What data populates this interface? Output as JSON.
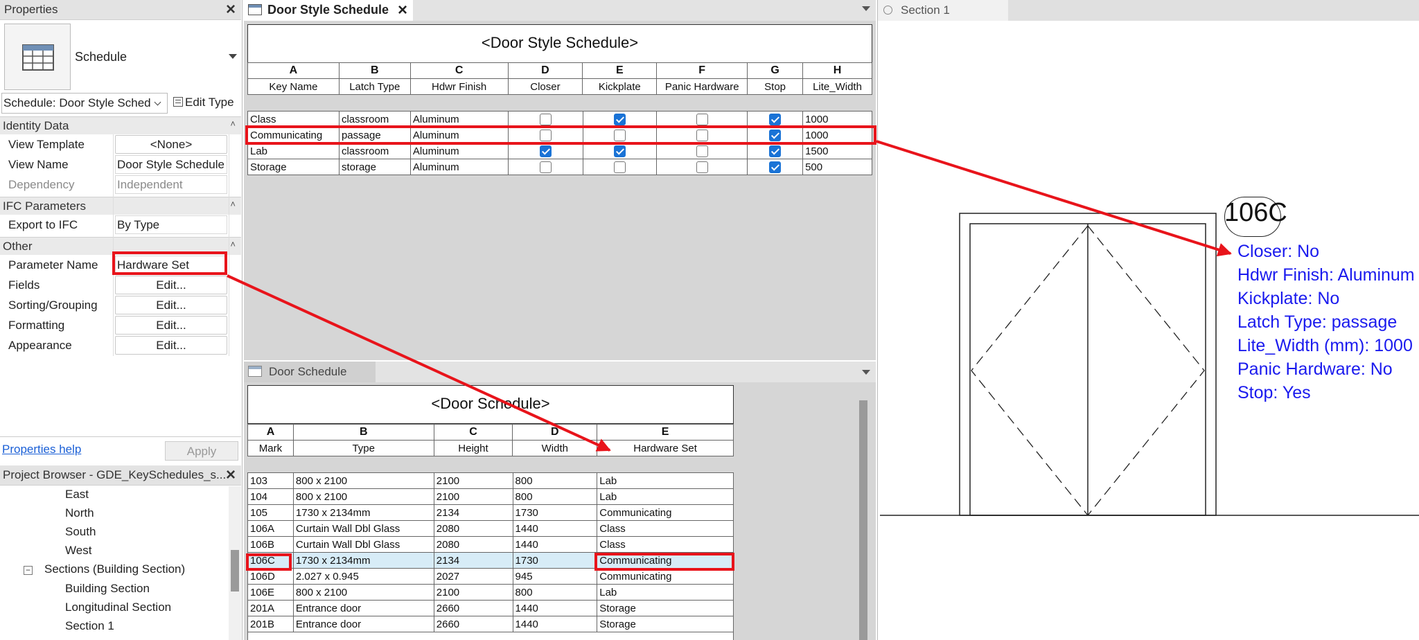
{
  "properties": {
    "title": "Properties",
    "type_name": "Schedule",
    "instance_selector": "Schedule: Door Style Sched",
    "edit_type": "Edit Type",
    "groups": [
      {
        "name": "Identity Data"
      },
      {
        "name": "IFC Parameters"
      },
      {
        "name": "Other"
      }
    ],
    "rows": {
      "view_template": {
        "label": "View Template",
        "value": "<None>"
      },
      "view_name": {
        "label": "View Name",
        "value": "Door Style Schedule"
      },
      "dependency": {
        "label": "Dependency",
        "value": "Independent"
      },
      "export_ifc": {
        "label": "Export to IFC",
        "value": "By Type"
      },
      "param_name": {
        "label": "Parameter Name",
        "value": "Hardware Set"
      },
      "fields": {
        "label": "Fields",
        "value": "Edit..."
      },
      "sorting": {
        "label": "Sorting/Grouping",
        "value": "Edit..."
      },
      "formatting": {
        "label": "Formatting",
        "value": "Edit..."
      },
      "appearance": {
        "label": "Appearance",
        "value": "Edit..."
      }
    },
    "help": "Properties help",
    "apply": "Apply"
  },
  "browser": {
    "title": "Project Browser - GDE_KeySchedules_s...",
    "items": [
      "East",
      "North",
      "South",
      "West",
      "Sections (Building Section)",
      "Building Section",
      "Longitudinal Section",
      "Section 1"
    ]
  },
  "tabs": {
    "door_style": "Door Style Schedule",
    "door": "Door Schedule",
    "section": "Section 1"
  },
  "door_style_schedule": {
    "title": "<Door Style Schedule>",
    "letters": [
      "A",
      "B",
      "C",
      "D",
      "E",
      "F",
      "G",
      "H"
    ],
    "headers": [
      "Key Name",
      "Latch Type",
      "Hdwr Finish",
      "Closer",
      "Kickplate",
      "Panic Hardware",
      "Stop",
      "Lite_Width"
    ],
    "rows": [
      {
        "key": "Class",
        "latch": "classroom",
        "finish": "Aluminum",
        "closer": false,
        "kick": true,
        "panic": false,
        "stop": true,
        "lite": "1000"
      },
      {
        "key": "Communicating",
        "latch": "passage",
        "finish": "Aluminum",
        "closer": false,
        "kick": false,
        "panic": false,
        "stop": true,
        "lite": "1000"
      },
      {
        "key": "Lab",
        "latch": "classroom",
        "finish": "Aluminum",
        "closer": true,
        "kick": true,
        "panic": false,
        "stop": true,
        "lite": "1500"
      },
      {
        "key": "Storage",
        "latch": "storage",
        "finish": "Aluminum",
        "closer": false,
        "kick": false,
        "panic": false,
        "stop": true,
        "lite": "500"
      }
    ]
  },
  "door_schedule": {
    "title": "<Door Schedule>",
    "letters": [
      "A",
      "B",
      "C",
      "D",
      "E"
    ],
    "headers": [
      "Mark",
      "Type",
      "Height",
      "Width",
      "Hardware Set"
    ],
    "rows": [
      [
        "103",
        "800 x 2100",
        "2100",
        "800",
        "Lab"
      ],
      [
        "104",
        "800 x 2100",
        "2100",
        "800",
        "Lab"
      ],
      [
        "105",
        "1730 x 2134mm",
        "2134",
        "1730",
        "Communicating"
      ],
      [
        "106A",
        "Curtain Wall Dbl Glass",
        "2080",
        "1440",
        "Class"
      ],
      [
        "106B",
        "Curtain Wall Dbl Glass",
        "2080",
        "1440",
        "Class"
      ],
      [
        "106C",
        "1730 x 2134mm",
        "2134",
        "1730",
        "Communicating"
      ],
      [
        "106D",
        "2.027 x 0.945",
        "2027",
        "945",
        "Communicating"
      ],
      [
        "106E",
        "800 x 2100",
        "2100",
        "800",
        "Lab"
      ],
      [
        "201A",
        "Entrance door",
        "2660",
        "1440",
        "Storage"
      ],
      [
        "201B",
        "Entrance door",
        "2660",
        "1440",
        "Storage"
      ]
    ]
  },
  "section_view": {
    "tag": "106C",
    "annotations": [
      "Closer: No",
      "Hdwr Finish: Aluminum",
      "Kickplate: No",
      "Latch Type: passage",
      "Lite_Width (mm): 1000",
      "Panic Hardware: No",
      "Stop: Yes"
    ]
  },
  "colors": {
    "highlight": "#e8141b",
    "annotation": "#1a1aee",
    "checkbox_on": "#1a73d6"
  }
}
